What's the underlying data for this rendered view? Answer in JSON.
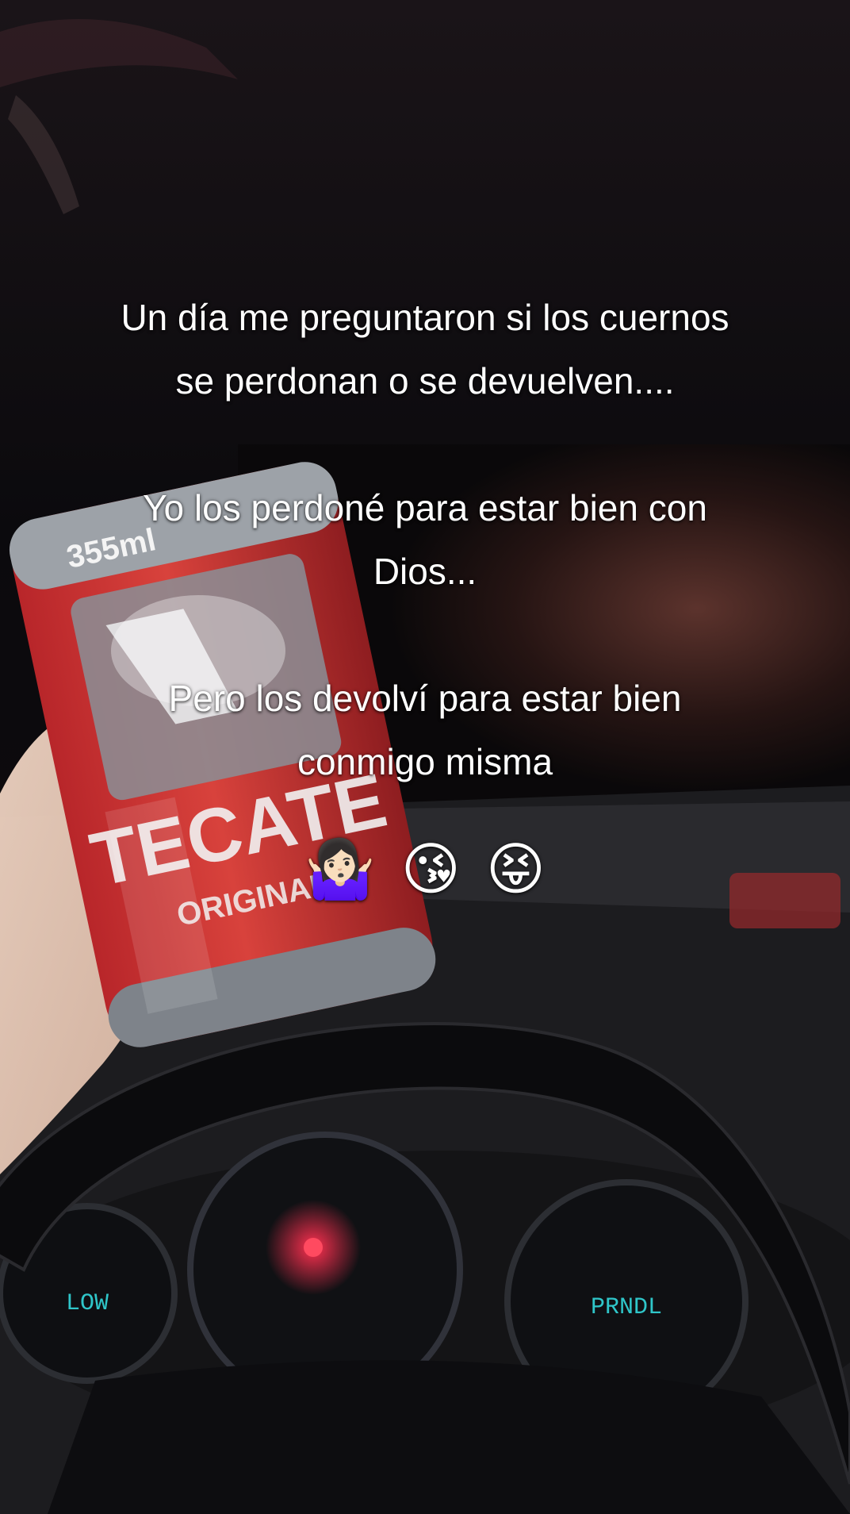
{
  "caption": {
    "lines": [
      "Un día me preguntaron si los cuernos",
      "se perdonan o se devuelven....",
      "",
      "Yo los perdoné para estar bien con",
      "Dios...",
      "",
      "Pero los devolví para estar bien",
      "conmigo misma"
    ],
    "emojis": [
      "🤷🏻‍♀️",
      "😘",
      "😝"
    ]
  },
  "can": {
    "brand": "TECATE",
    "variant": "ORIGINAL",
    "volume": "355ml"
  },
  "dashboard": {
    "left_gauge_text": "LOW",
    "right_gauge_text": "PRNDL"
  }
}
